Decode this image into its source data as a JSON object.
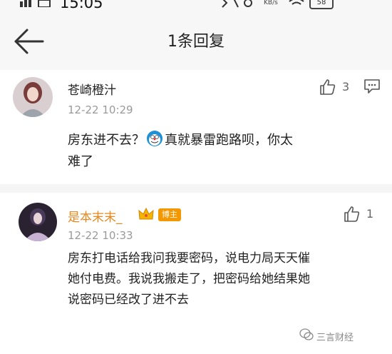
{
  "status_bar": {
    "time": "15:05",
    "net_speed": "KB/s",
    "battery": "58"
  },
  "nav": {
    "title": "1条回复"
  },
  "comment": {
    "username": "苍崎橙汁",
    "timestamp": "12-22 10:29",
    "likes": "3",
    "content_line1_a": "房东进不去？",
    "content_line1_b": "真就暴雷跑路呗，你太",
    "content_line2": "难了"
  },
  "reply": {
    "username": "是本末末_",
    "badge": "博主",
    "timestamp": "12-22 10:33",
    "likes": "1",
    "content_lines": [
      "房东打电话给我问我要密码，说电力局天天催",
      "她付电费。我说我搬走了，把密码给她结果她",
      "说密码已经改了进不去"
    ]
  },
  "watermark": {
    "text": "三言财经"
  },
  "colors": {
    "username_reply": "#e8871e",
    "badge_bg": "#f39800",
    "timestamp": "#9a9a9a"
  }
}
